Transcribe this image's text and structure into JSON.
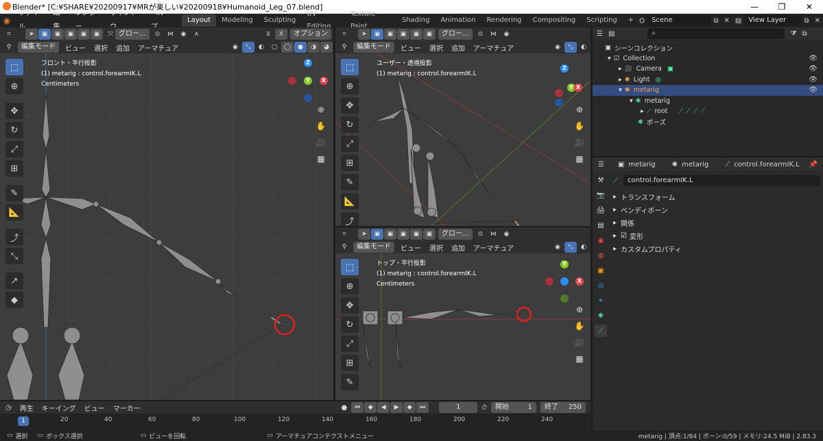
{
  "window": {
    "title": "Blender* [C:¥SHARE¥20200917¥MRが楽しい¥20200918¥Humanoid_Leg_07.blend]",
    "min": "—",
    "max": "❐",
    "close": "✕"
  },
  "menu": [
    "ファイル",
    "編集",
    "レンダー",
    "ウィンドウ",
    "ヘルプ"
  ],
  "workspaces": [
    "Layout",
    "Modeling",
    "Sculpting",
    "UV Editing",
    "Texture Paint",
    "Shading",
    "Animation",
    "Rendering",
    "Compositing",
    "Scripting"
  ],
  "workspace_add": "+",
  "scene": "Scene",
  "view_layer": "View Layer",
  "vp_left": {
    "orient": "グロー...",
    "options": "オプション",
    "mode": "編集モード",
    "menus": [
      "ビュー",
      "選択",
      "追加",
      "アーマチュア"
    ],
    "view_name": "フロント・平行投影",
    "active": "(1) metarig : control.forearmIK.L",
    "units": "Centimeters",
    "axis_z": "Z",
    "axis_y": "Y",
    "axis_x": "X"
  },
  "vp_persp": {
    "orient": "グロー...",
    "mode": "編集モード",
    "menus": [
      "ビュー",
      "選択",
      "追加",
      "アーマチュア"
    ],
    "view_name": "ユーザー・透視投影",
    "active": "(1) metarig : control.forearmIK.L",
    "axis_z": "Z",
    "axis_y": "Y",
    "axis_x": "X"
  },
  "vp_top": {
    "orient": "グロー...",
    "mode": "編集モード",
    "menus": [
      "ビュー",
      "選択",
      "追加",
      "アーマチュア"
    ],
    "view_name": "トップ・平行投影",
    "active": "(1) metarig : control.forearmIK.L",
    "units": "Centimeters",
    "axis_y": "Y",
    "axis_x": "X"
  },
  "outliner": {
    "root": "シーンコレクション",
    "rows": [
      "Collection",
      "Camera",
      "Light",
      "metarig",
      "metarig",
      "root",
      "ポーズ"
    ]
  },
  "properties": {
    "breadcrumb": [
      "metarig",
      "metarig",
      "control.forearmIK.L"
    ],
    "bone_name": "control.forearmIK.L",
    "panels": [
      "トランスフォーム",
      "ベンディボーン",
      "関係",
      "変形",
      "カスタムプロパティ"
    ]
  },
  "timeline": {
    "menus": [
      "再生",
      "キーイング",
      "ビュー",
      "マーカー"
    ],
    "current_frame": "1",
    "start_label": "開始",
    "start": "1",
    "end_label": "終了",
    "end": "250",
    "ruler": [
      "1",
      "20",
      "40",
      "60",
      "80",
      "100",
      "120",
      "140",
      "160",
      "180",
      "200",
      "220",
      "240"
    ]
  },
  "status": {
    "select": "選択",
    "box_select": "ボックス選択",
    "rotate_view": "ビューを回転",
    "context_menu": "アーマチュアコンテクストメニュー",
    "info": "metarig | 頂点:1/84 | ボーン:0/59 | メモリ:24.5 MiB | 2.83.3"
  },
  "colors": {
    "accent": "#4772b3",
    "axis_x": "#e8414d",
    "axis_y": "#8ac926",
    "axis_z": "#2c8fff",
    "highlight_ring": "#e02020"
  }
}
